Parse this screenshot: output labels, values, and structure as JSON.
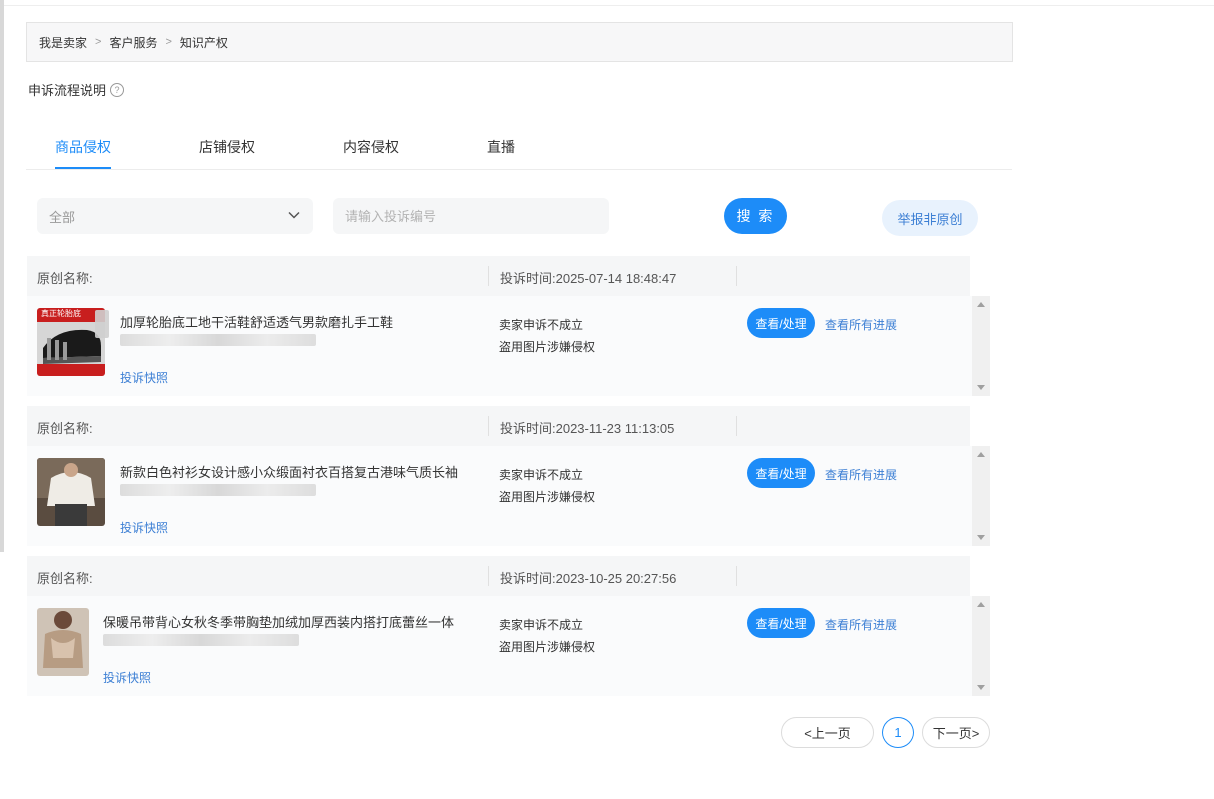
{
  "breadcrumb": {
    "items": [
      "我是卖家",
      "客户服务",
      "知识产权"
    ],
    "separator": ">"
  },
  "help": {
    "label": "申诉流程说明",
    "icon": "question-circle-icon"
  },
  "tabs": [
    {
      "label": "商品侵权",
      "active": true
    },
    {
      "label": "店铺侵权",
      "active": false
    },
    {
      "label": "内容侵权",
      "active": false
    },
    {
      "label": "直播",
      "active": false
    }
  ],
  "filters": {
    "status_select": {
      "value": "全部"
    },
    "search": {
      "placeholder": "请输入投诉编号",
      "value": ""
    },
    "search_button": "搜 索",
    "report_button": "举报非原创"
  },
  "records": [
    {
      "original_label": "原创名称:",
      "complaint_time": "投诉时间:2025-07-14 18:48:47",
      "title": "加厚轮胎底工地干活鞋舒适透气男款磨扎手工鞋",
      "thumb_label": "真正轮胎底",
      "snapshot_link": "投诉快照",
      "status_line1": "卖家申诉不成立",
      "status_line2": "盗用图片涉嫌侵权",
      "handle_button": "查看/处理",
      "progress_link": "查看所有进展"
    },
    {
      "original_label": "原创名称:",
      "complaint_time": "投诉时间:2023-11-23 11:13:05",
      "title": "新款白色衬衫女设计感小众缎面衬衣百搭复古港味气质长袖",
      "thumb_label": "",
      "snapshot_link": "投诉快照",
      "status_line1": "卖家申诉不成立",
      "status_line2": "盗用图片涉嫌侵权",
      "handle_button": "查看/处理",
      "progress_link": "查看所有进展"
    },
    {
      "original_label": "原创名称:",
      "complaint_time": "投诉时间:2023-10-25 20:27:56",
      "title": "保暖吊带背心女秋冬季带胸垫加绒加厚西装内搭打底蕾丝一体",
      "thumb_label": "",
      "snapshot_link": "投诉快照",
      "status_line1": "卖家申诉不成立",
      "status_line2": "盗用图片涉嫌侵权",
      "handle_button": "查看/处理",
      "progress_link": "查看所有进展"
    }
  ],
  "pagination": {
    "prev": "<上一页",
    "current": "1",
    "next": "下一页>"
  },
  "colors": {
    "accent": "#1d8cf8",
    "link": "#3c7fd4",
    "header_bg": "#f5f6f7"
  }
}
